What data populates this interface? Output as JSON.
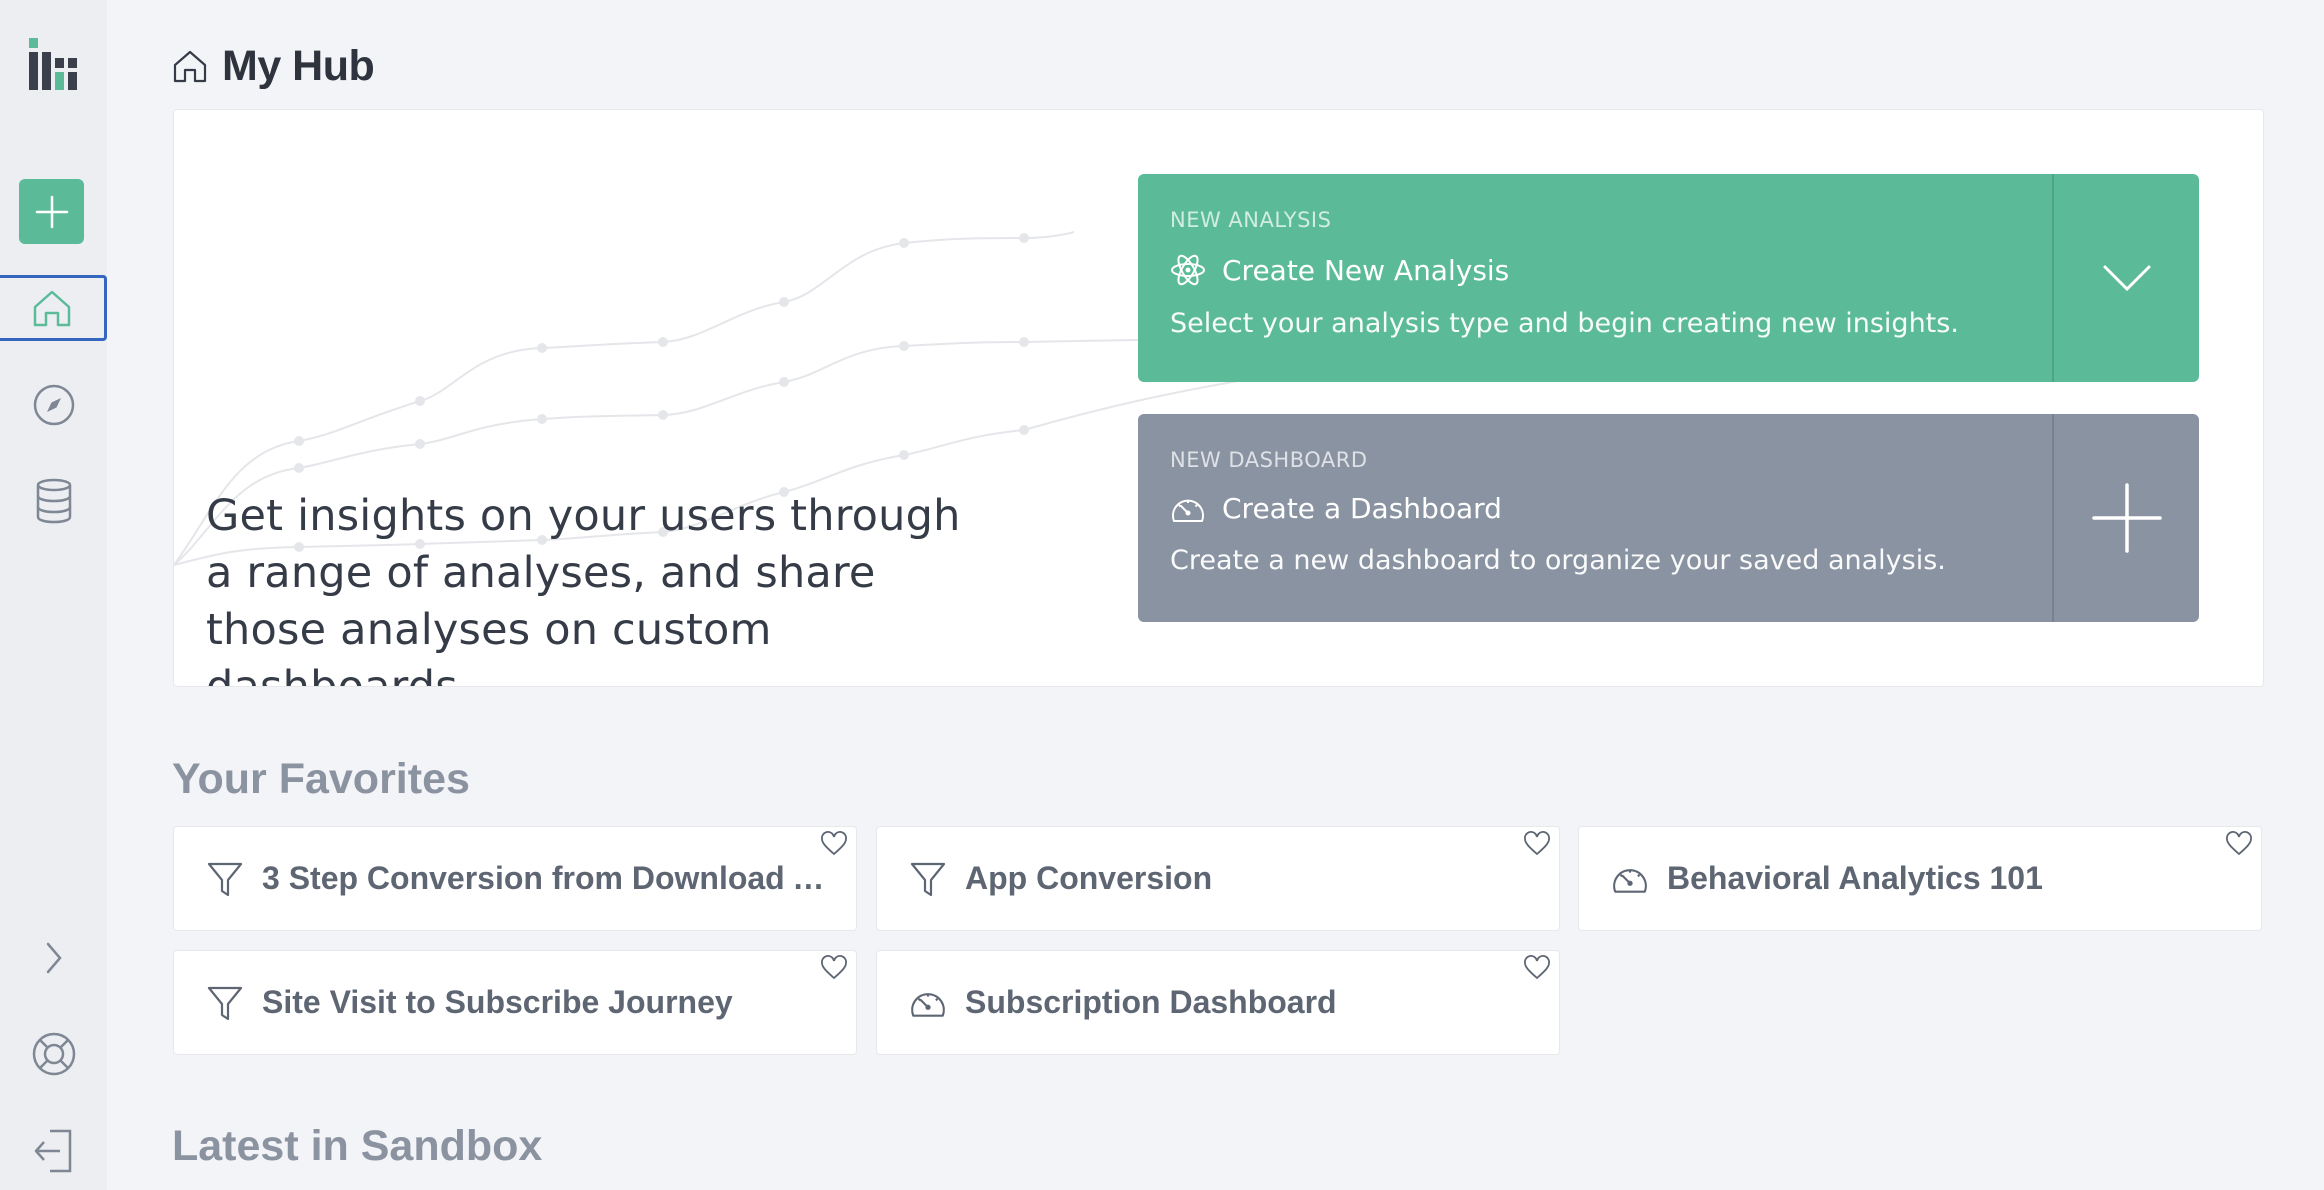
{
  "page": {
    "title": "My Hub"
  },
  "hero": {
    "text": "Get insights on your users through a range of analyses, and share those analyses on custom dashboards."
  },
  "new_analysis": {
    "eyebrow": "NEW ANALYSIS",
    "title": "Create New Analysis",
    "description": "Select your analysis type and begin creating new insights."
  },
  "new_dashboard": {
    "eyebrow": "NEW DASHBOARD",
    "title": "Create a Dashboard",
    "description": "Create a new dashboard to organize your saved analysis."
  },
  "favorites": {
    "title": "Your Favorites",
    "items": [
      {
        "label": "3 Step Conversion from Download A...",
        "icon": "funnel-icon"
      },
      {
        "label": "App Conversion",
        "icon": "funnel-icon"
      },
      {
        "label": "Behavioral Analytics 101",
        "icon": "dashboard-gauge-icon"
      },
      {
        "label": "Site Visit to Subscribe Journey",
        "icon": "funnel-icon"
      },
      {
        "label": "Subscription Dashboard",
        "icon": "dashboard-gauge-icon"
      }
    ]
  },
  "latest": {
    "title": "Latest in Sandbox"
  },
  "colors": {
    "accent_green": "#5bbb98",
    "dashboard_gray": "#8a93a2",
    "active_outline": "#3466c0"
  }
}
